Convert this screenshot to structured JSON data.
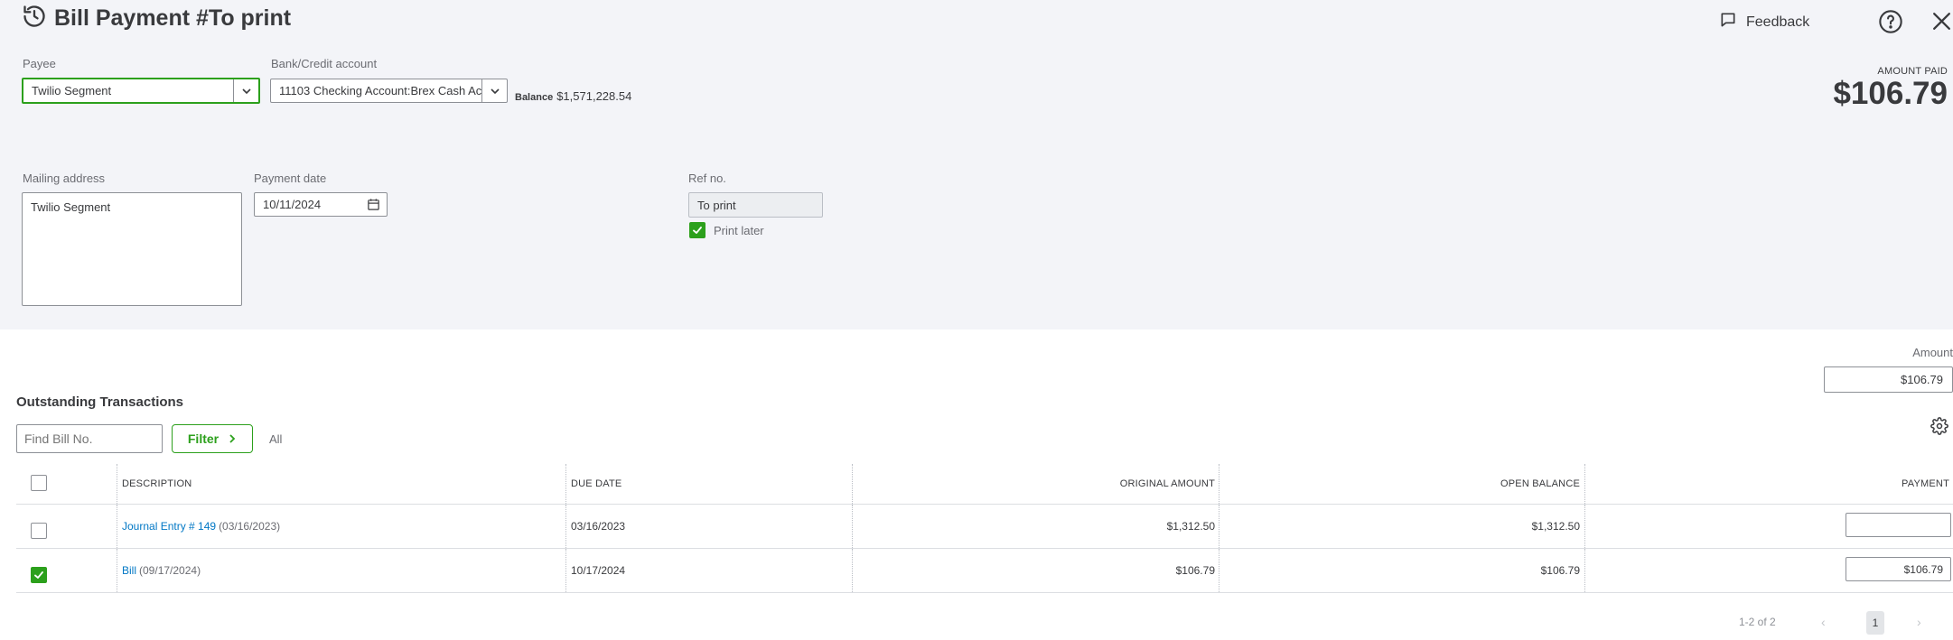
{
  "header": {
    "title": "Bill Payment #To print",
    "feedback_label": "Feedback",
    "icons": [
      "history-icon",
      "feedback-icon",
      "help-icon",
      "close-icon"
    ]
  },
  "form": {
    "payee_label": "Payee",
    "payee_value": "Twilio Segment",
    "bank_label": "Bank/Credit account",
    "bank_value": "11103 Checking Account:Brex Cash Ac",
    "balance_label": "Balance",
    "balance_value": "$1,571,228.54",
    "amount_paid_label": "AMOUNT PAID",
    "amount_paid_value": "$106.79",
    "mailing_label": "Mailing address",
    "mailing_value": "Twilio Segment",
    "payment_date_label": "Payment date",
    "payment_date_value": "10/11/2024",
    "ref_label": "Ref no.",
    "ref_value": "To print",
    "print_later_label": "Print later",
    "print_later_checked": true
  },
  "outstanding": {
    "amount_label": "Amount",
    "amount_value": "$106.79",
    "title": "Outstanding Transactions",
    "find_placeholder": "Find Bill No.",
    "filter_label": "Filter",
    "all_label": "All",
    "columns": {
      "description": "DESCRIPTION",
      "due_date": "DUE DATE",
      "original_amount": "ORIGINAL AMOUNT",
      "open_balance": "OPEN BALANCE",
      "payment": "PAYMENT"
    },
    "rows": [
      {
        "checked": false,
        "link": "Journal Entry # 149",
        "date": "(03/16/2023)",
        "due_date": "03/16/2023",
        "original_amount": "$1,312.50",
        "open_balance": "$1,312.50",
        "payment": ""
      },
      {
        "checked": true,
        "link": "Bill",
        "date": "(09/17/2024)",
        "due_date": "10/17/2024",
        "original_amount": "$106.79",
        "open_balance": "$106.79",
        "payment": "$106.79"
      }
    ],
    "pager": {
      "range": "1-2 of 2",
      "prev": "‹",
      "page": "1",
      "next": "›"
    }
  },
  "colors": {
    "accent": "#2ca01c",
    "link": "#0077c5",
    "form_bg": "#f3f4f8"
  }
}
